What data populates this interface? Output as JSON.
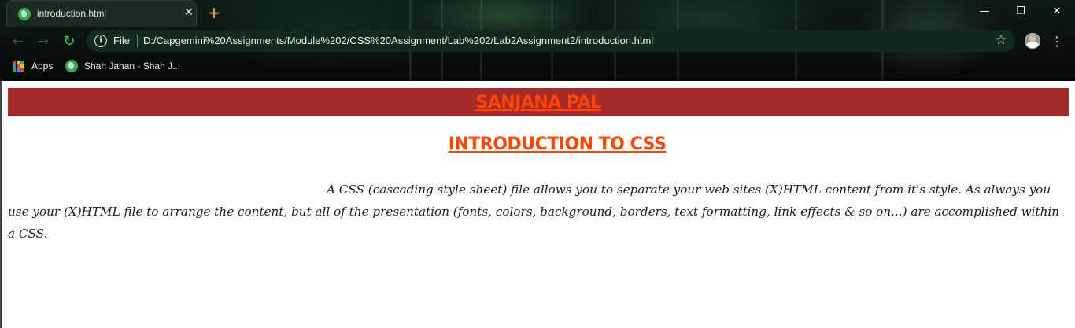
{
  "browser": {
    "tab": {
      "title": "introduction.html",
      "close": "✕"
    },
    "new_tab": "+",
    "window_controls": {
      "minimize": "—",
      "maximize": "❐",
      "close": "✕"
    },
    "nav": {
      "back": "←",
      "forward": "→",
      "reload": "↻"
    },
    "omnibox": {
      "info": "i",
      "scheme": "File",
      "url": "D:/Capgemini%20Assignments/Module%202/CSS%20Assignment/Lab%202/Lab2Assignment2/introduction.html",
      "star": "☆"
    },
    "menu": "⋮",
    "bookmarks": [
      {
        "label": "Apps",
        "icon": "apps-grid-icon"
      },
      {
        "label": "Shah Jahan - Shah J...",
        "icon": "globe-icon"
      }
    ],
    "apps_colors": [
      "#ea4335",
      "#fbbc05",
      "#34a853",
      "#4285f4",
      "#ea4335",
      "#fbbc05",
      "#34a853",
      "#4285f4",
      "#ea4335"
    ]
  },
  "page": {
    "banner": {
      "title": "SANJANA PAL",
      "background": "#a52a2a",
      "color": "#ff4500"
    },
    "heading": {
      "text": "INTRODUCTION TO CSS",
      "color": "#ff4500"
    },
    "paragraph": "A CSS (cascading style sheet) file allows you to separate your web sites (X)HTML content from it's style. As always you use your (X)HTML file to arrange the content, but all of the presentation (fonts, colors, background, borders, text formatting, link effects & so on...) are accomplished within a CSS."
  }
}
